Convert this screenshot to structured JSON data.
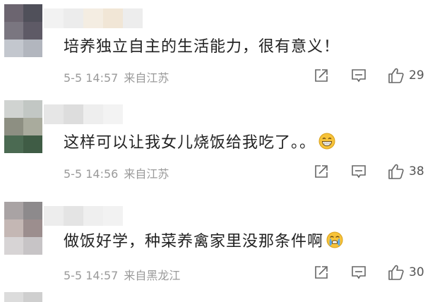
{
  "comments": [
    {
      "text": "培养独立自主的生活能力，很有意义！",
      "time": "5-5 14:57",
      "location": "来自江苏",
      "likes": "29",
      "emoji": "",
      "avatar_colors": [
        "#6c6570",
        "#50505a",
        "#7a7680",
        "#5e5a66",
        "#c3c7ce",
        "#b2b6be"
      ],
      "name_colors": [
        "#f2f2f2",
        "#ececec",
        "#f4ede2",
        "#f1e6d6",
        "#ededed"
      ]
    },
    {
      "text": "这样可以让我女儿烧饭给我吃了。。",
      "time": "5-5 14:56",
      "location": "来自江苏",
      "likes": "38",
      "emoji": "grinning-face",
      "avatar_colors": [
        "#d0d3d1",
        "#c2c7c4",
        "#8d8f82",
        "#a9ab9d",
        "#4b6a52",
        "#3f5c45"
      ],
      "name_colors": [
        "#e6e6e6",
        "#dddddd",
        "#eeeeee",
        "#f3f3f3"
      ]
    },
    {
      "text": "做饭好学，种菜养禽家里没那条件啊",
      "time": "5-5 14:57",
      "location": "来自黑龙江",
      "likes": "30",
      "emoji": "crying-face",
      "avatar_colors": [
        "#a9a3a4",
        "#8d8a8c",
        "#c4b7b4",
        "#9c8e8e",
        "#d7d4d5",
        "#c7c4c6"
      ],
      "name_colors": [
        "#ededed",
        "#e4e4e4",
        "#efefef",
        "#f2f2f2"
      ]
    }
  ]
}
